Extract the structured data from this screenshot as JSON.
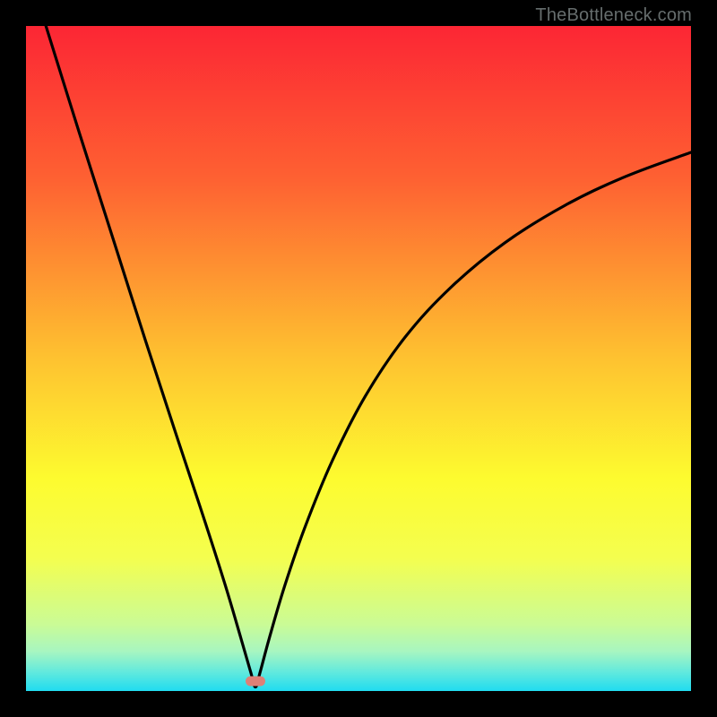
{
  "watermark": "TheBottleneck.com",
  "chart_data": {
    "type": "line",
    "title": "",
    "xlabel": "",
    "ylabel": "",
    "xlim": [
      0,
      100
    ],
    "ylim": [
      0,
      100
    ],
    "min_x": 34.5,
    "marker": {
      "x": 34.5,
      "y": 1.5,
      "color": "#de8077"
    },
    "gradient_stops": [
      {
        "pct": 0,
        "color": "#fc2634"
      },
      {
        "pct": 23,
        "color": "#fe6132"
      },
      {
        "pct": 50,
        "color": "#fec230"
      },
      {
        "pct": 68,
        "color": "#fdfb2f"
      },
      {
        "pct": 80,
        "color": "#f4fe4f"
      },
      {
        "pct": 90,
        "color": "#cafb96"
      },
      {
        "pct": 94,
        "color": "#a8f6c0"
      },
      {
        "pct": 97,
        "color": "#65eadc"
      },
      {
        "pct": 100,
        "color": "#20dcf0"
      }
    ],
    "left_arm": {
      "comment": "left descending branch, points (x, y) in 0..100 coords",
      "points": [
        [
          3.0,
          100.0
        ],
        [
          8.0,
          84.0
        ],
        [
          13.0,
          68.3
        ],
        [
          18.0,
          52.6
        ],
        [
          23.0,
          37.3
        ],
        [
          27.0,
          25.2
        ],
        [
          30.0,
          15.8
        ],
        [
          32.3,
          8.0
        ],
        [
          33.8,
          2.8
        ],
        [
          34.5,
          0.6
        ]
      ]
    },
    "right_arm": {
      "comment": "right ascending branch, points (x, y) in 0..100 coords",
      "points": [
        [
          34.5,
          0.6
        ],
        [
          35.2,
          2.8
        ],
        [
          36.6,
          8.0
        ],
        [
          38.9,
          15.8
        ],
        [
          41.9,
          24.5
        ],
        [
          46.0,
          34.5
        ],
        [
          51.0,
          44.3
        ],
        [
          57.0,
          53.2
        ],
        [
          64.0,
          60.8
        ],
        [
          72.0,
          67.4
        ],
        [
          81.0,
          73.0
        ],
        [
          90.0,
          77.3
        ],
        [
          100.0,
          81.0
        ]
      ]
    }
  }
}
